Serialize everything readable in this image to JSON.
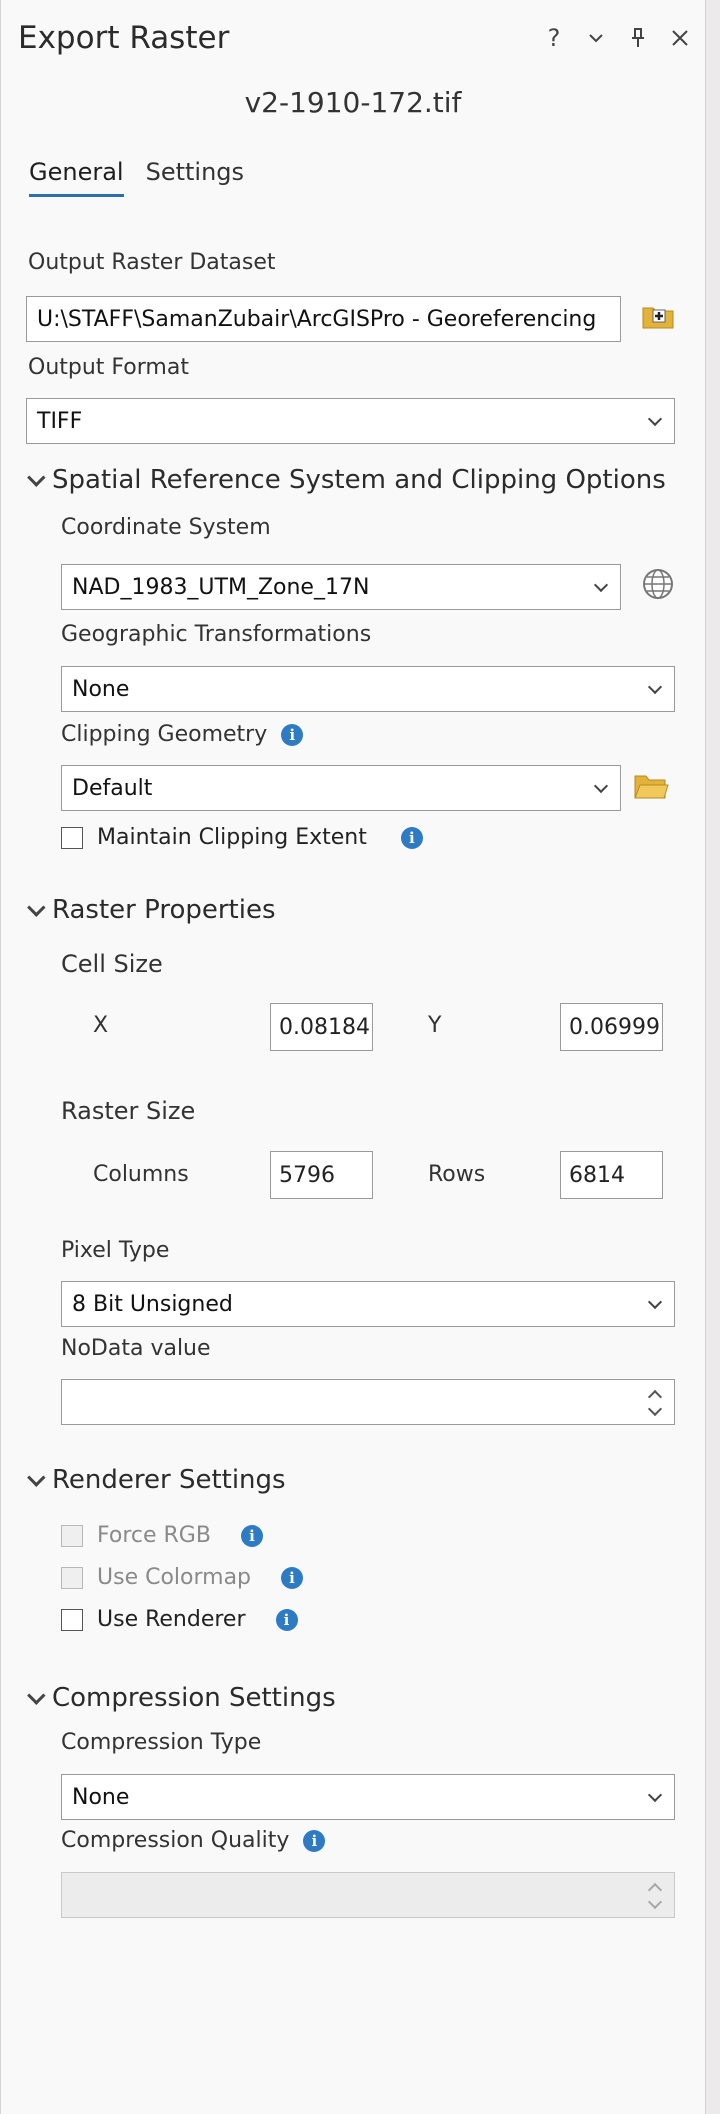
{
  "window": {
    "title": "Export Raster",
    "subtitle": "v2-1910-172.tif",
    "help_glyph": "?",
    "menu_glyph": "⌄",
    "pin_glyph": "ᛘ",
    "close_glyph": "✕"
  },
  "tabs": [
    {
      "label": "General",
      "active": true
    },
    {
      "label": "Settings",
      "active": false
    }
  ],
  "output": {
    "dataset_label": "Output Raster Dataset",
    "dataset_value": "U:\\STAFF\\SamanZubair\\ArcGISPro - Georeferencing",
    "format_label": "Output Format",
    "format_value": "TIFF"
  },
  "spatial": {
    "header": "Spatial Reference System and Clipping Options",
    "coord_label": "Coordinate System",
    "coord_value": "NAD_1983_UTM_Zone_17N",
    "geo_label": "Geographic Transformations",
    "geo_value": "None",
    "clip_label": "Clipping Geometry",
    "clip_value": "Default",
    "maintain_label": "Maintain Clipping Extent"
  },
  "raster": {
    "header": "Raster Properties",
    "cell_size_label": "Cell Size",
    "x_label": "X",
    "x_value": "0.08184",
    "y_label": "Y",
    "y_value": "0.06999",
    "raster_size_label": "Raster Size",
    "columns_label": "Columns",
    "columns_value": "5796",
    "rows_label": "Rows",
    "rows_value": "6814",
    "pixel_type_label": "Pixel Type",
    "pixel_type_value": "8 Bit Unsigned",
    "nodata_label": "NoData value",
    "nodata_value": ""
  },
  "renderer": {
    "header": "Renderer Settings",
    "force_rgb": "Force RGB",
    "use_colormap": "Use Colormap",
    "use_renderer": "Use Renderer"
  },
  "compression": {
    "header": "Compression Settings",
    "type_label": "Compression Type",
    "type_value": "None",
    "quality_label": "Compression Quality",
    "quality_value": ""
  },
  "colors": {
    "accent": "#2a6fb0",
    "info": "#2e7bc4",
    "folder": "#e2b23a"
  },
  "info_glyph": "i"
}
